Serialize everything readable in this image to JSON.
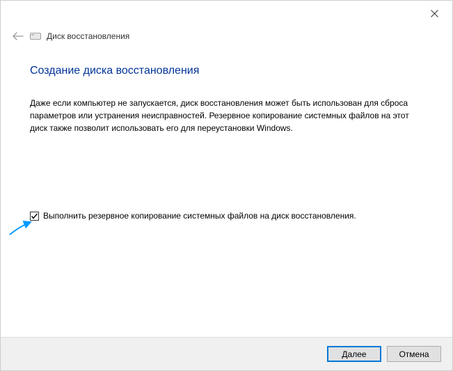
{
  "titlebar": {
    "close_tooltip": "Закрыть"
  },
  "header": {
    "breadcrumb": "Диск восстановления"
  },
  "main": {
    "heading": "Создание диска восстановления",
    "description": "Даже если компьютер не запускается, диск восстановления может быть использован для сброса параметров или устранения неисправностей. Резервное копирование системных файлов на этот диск также позволит использовать его для переустановки Windows.",
    "checkbox_label": "Выполнить резервное копирование системных файлов на диск восстановления.",
    "checkbox_checked": true
  },
  "footer": {
    "next_label": "Далее",
    "cancel_label": "Отмена"
  }
}
